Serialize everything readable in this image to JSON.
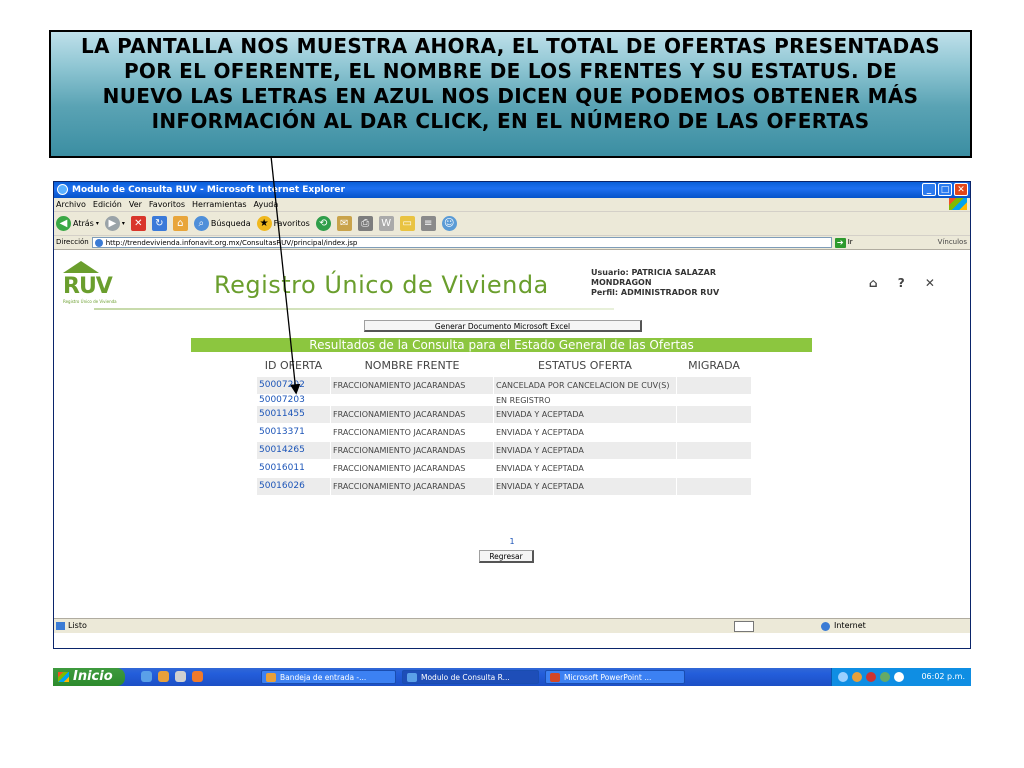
{
  "annotation": {
    "text": "LA PANTALLA NOS MUESTRA AHORA, EL TOTAL DE OFERTAS PRESENTADAS POR EL OFERENTE, EL NOMBRE DE LOS FRENTES Y SU ESTATUS. DE NUEVO LAS LETRAS EN AZUL NOS DICEN QUE PODEMOS OBTENER MÁS INFORMACIÓN AL DAR CLICK, EN EL NÚMERO  DE LAS OFERTAS"
  },
  "window": {
    "title": "Modulo de Consulta RUV - Microsoft Internet Explorer",
    "menu": [
      "Archivo",
      "Edición",
      "Ver",
      "Favoritos",
      "Herramientas",
      "Ayuda"
    ],
    "toolbar": {
      "back": "Atrás",
      "search": "Búsqueda",
      "favorites": "Favoritos"
    },
    "address_label": "Dirección",
    "address_url": "http://trendevivienda.infonavit.org.mx/ConsultasRUV/principal/index.jsp",
    "go_label": "Ir",
    "links_label": "Vínculos",
    "status_left": "Listo",
    "status_zone": "Internet"
  },
  "site": {
    "logo_text": "RUV",
    "logo_sub": "Registro Único de Vivienda",
    "title": "Registro Único de Vivienda",
    "user_line1": "Usuario: PATRICIA SALAZAR",
    "user_line2": "MONDRAGON",
    "user_line3": "Perfil: ADMINISTRADOR RUV",
    "header_icons": "⌂ ? ✕"
  },
  "main": {
    "excel_button": "Generar Documento Microsoft Excel",
    "results_title": "Resultados de la Consulta para el Estado General de las Ofertas",
    "columns": [
      "ID OFERTA",
      "NOMBRE FRENTE",
      "ESTATUS OFERTA",
      "MIGRADA"
    ],
    "rows": [
      {
        "id": "50007202",
        "frente": "FRACCIONAMIENTO JACARANDAS",
        "estatus": "CANCELADA POR CANCELACION DE CUV(S)",
        "migrada": ""
      },
      {
        "id": "50007203",
        "frente": "",
        "estatus": "EN REGISTRO",
        "migrada": ""
      },
      {
        "id": "50011455",
        "frente": "FRACCIONAMIENTO JACARANDAS",
        "estatus": "ENVIADA Y ACEPTADA",
        "migrada": ""
      },
      {
        "id": "50013371",
        "frente": "FRACCIONAMIENTO JACARANDAS",
        "estatus": "ENVIADA Y ACEPTADA",
        "migrada": ""
      },
      {
        "id": "50014265",
        "frente": "FRACCIONAMIENTO JACARANDAS",
        "estatus": "ENVIADA Y ACEPTADA",
        "migrada": ""
      },
      {
        "id": "50016011",
        "frente": "FRACCIONAMIENTO JACARANDAS",
        "estatus": "ENVIADA Y ACEPTADA",
        "migrada": ""
      },
      {
        "id": "50016026",
        "frente": "FRACCIONAMIENTO JACARANDAS",
        "estatus": "ENVIADA Y ACEPTADA",
        "migrada": ""
      }
    ],
    "page_number": "1",
    "back_button": "Regresar"
  },
  "taskbar": {
    "start": "Inicio",
    "tasks": [
      "Bandeja de entrada -...",
      "Modulo de Consulta R...",
      "Microsoft PowerPoint ..."
    ],
    "clock": "06:02 p.m."
  },
  "colors": {
    "accent_green": "#8cc63f",
    "link_blue": "#1c55b8",
    "xp_blue": "#245edb"
  }
}
